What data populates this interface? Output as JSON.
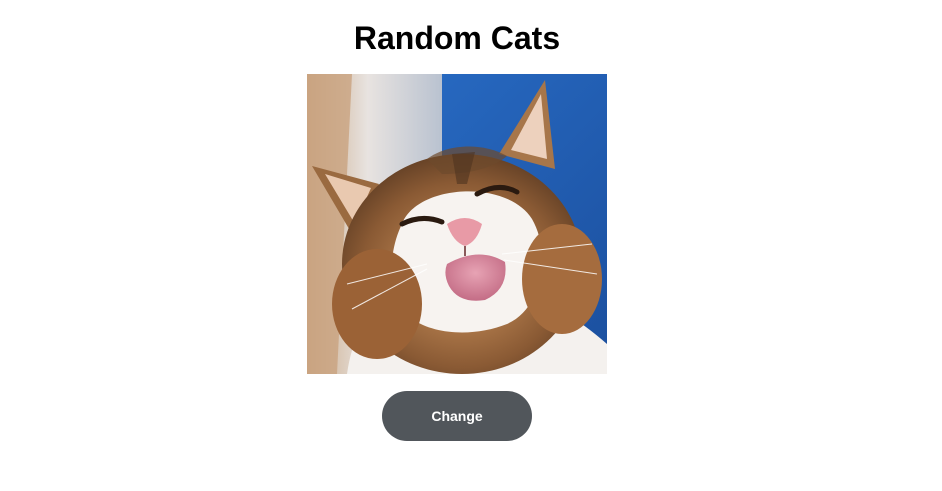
{
  "header": {
    "title": "Random Cats"
  },
  "image": {
    "subject": "cat"
  },
  "controls": {
    "change_label": "Change"
  },
  "colors": {
    "background": "#ffffff",
    "title": "#000000",
    "button_bg": "#51565b",
    "button_text": "#ffffff"
  }
}
